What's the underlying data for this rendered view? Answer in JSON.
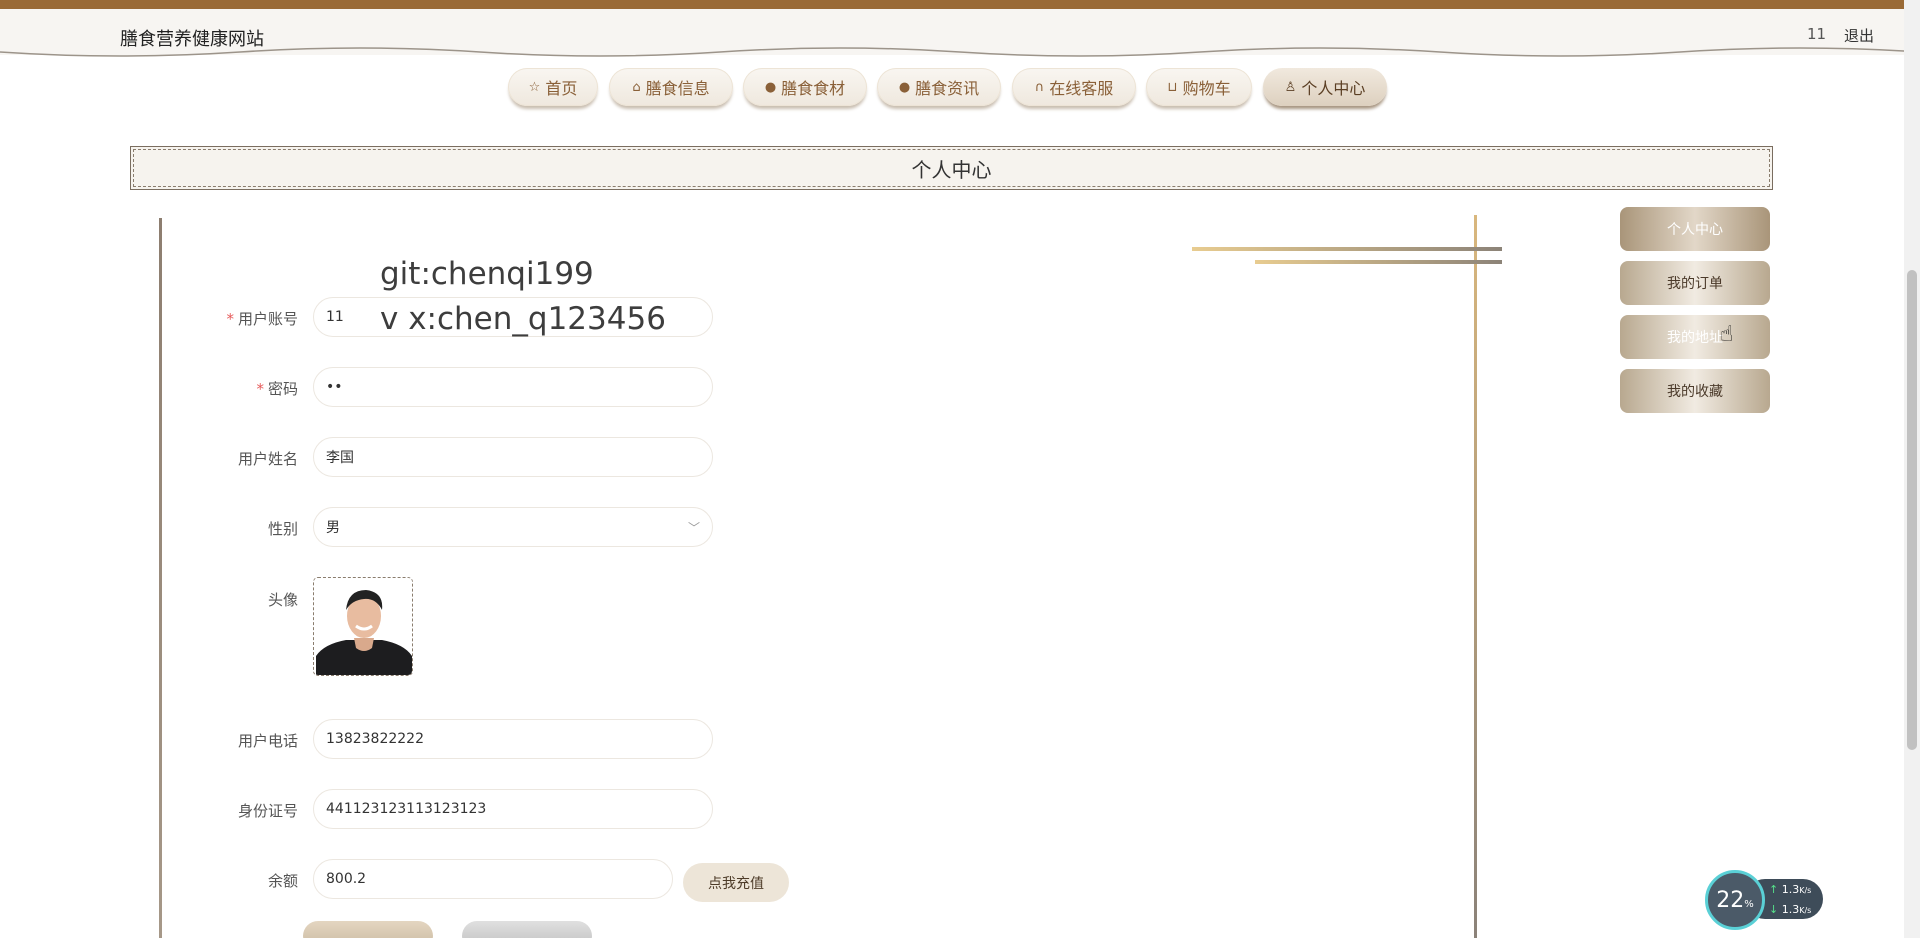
{
  "site": {
    "title": "膳食营养健康网站",
    "user_number": "11",
    "logout": "退出"
  },
  "nav": {
    "items": [
      {
        "icon": "☆",
        "label": "首页"
      },
      {
        "icon": "🛍",
        "label": "膳食信息"
      },
      {
        "icon": "❗",
        "label": "膳食食材"
      },
      {
        "icon": "❓",
        "label": "膳食资讯"
      },
      {
        "icon": "🎧",
        "label": "在线客服"
      },
      {
        "icon": "🛒",
        "label": "购物车"
      },
      {
        "icon": "👤",
        "label": "个人中心"
      }
    ],
    "active_index": 6
  },
  "section_title": "个人中心",
  "watermark": {
    "line1": "git:chenqi199",
    "line2": "v x:chen_q123456"
  },
  "form": {
    "account_label": "用户账号",
    "account_value": "11",
    "password_label": "密码",
    "password_value": "••",
    "name_label": "用户姓名",
    "name_value": "李国",
    "gender_label": "性别",
    "gender_value": "男",
    "avatar_label": "头像",
    "phone_label": "用户电话",
    "phone_value": "13823822222",
    "id_label": "身份证号",
    "id_value": "441123123113123123",
    "balance_label": "余额",
    "balance_value": "800.2",
    "recharge_button": "点我充值"
  },
  "side_menu": {
    "items": [
      "个人中心",
      "我的订单",
      "我的地址",
      "我的收藏"
    ]
  },
  "net_widget": {
    "percent": "22",
    "percent_unit": "%",
    "upload": "1.3",
    "download": "1.3",
    "unit": "K/s"
  }
}
